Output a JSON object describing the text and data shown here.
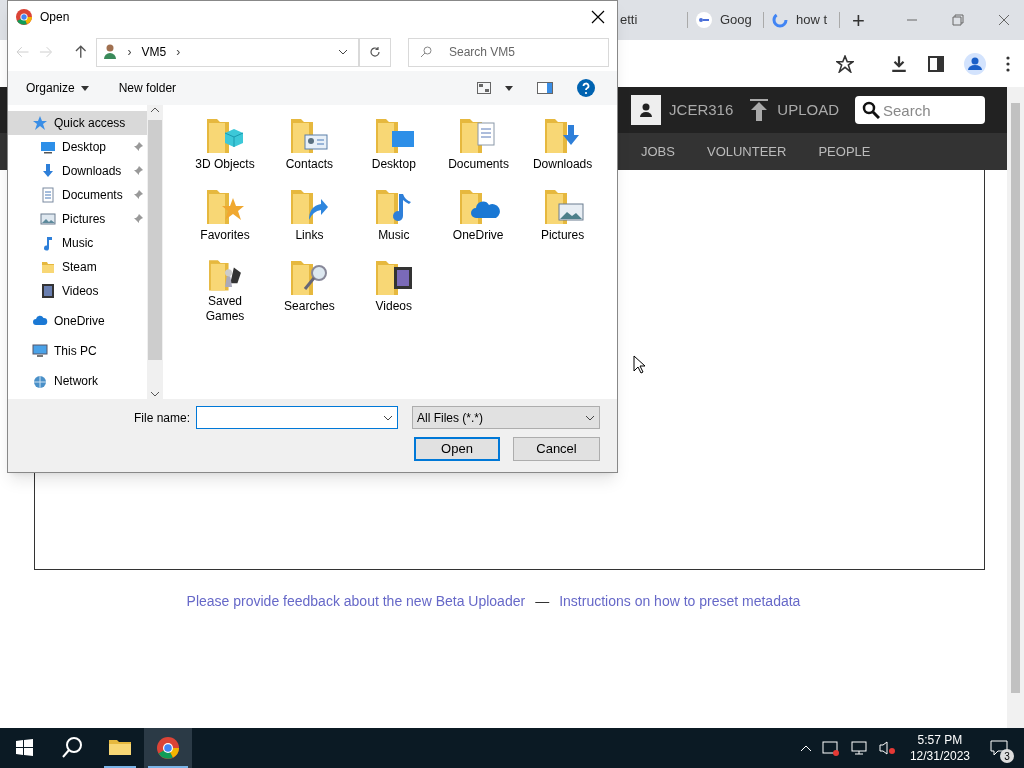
{
  "browser": {
    "tabs": [
      {
        "label": "etti",
        "kind": "plain"
      },
      {
        "label": "Goog",
        "kind": "key"
      },
      {
        "label": "how t",
        "kind": "google"
      }
    ],
    "new_tab": "+"
  },
  "site": {
    "user": "JCER316",
    "upload": "UPLOAD",
    "search": {
      "placeholder": "Search"
    },
    "nav": [
      "JOBS",
      "VOLUNTEER",
      "PEOPLE"
    ],
    "footer": {
      "links": [
        "Please provide feedback about the new Beta Uploader",
        "Instructions on how to preset metadata"
      ],
      "separator": "—"
    }
  },
  "dialog": {
    "title": "Open",
    "path": "VM5",
    "breadcrumb_separators": [
      "›",
      "›"
    ],
    "search": {
      "placeholder": "Search VM5"
    },
    "toolbar": [
      "Organize",
      "New folder"
    ],
    "sidebar": [
      {
        "label": "Quick access",
        "kind": "star",
        "selected": true,
        "children": [
          {
            "label": "Desktop",
            "kind": "desktop",
            "pinned": true,
            "selected": false
          },
          {
            "label": "Downloads",
            "kind": "download",
            "pinned": true,
            "selected": false
          },
          {
            "label": "Documents",
            "kind": "document",
            "pinned": true,
            "selected": false
          },
          {
            "label": "Pictures",
            "kind": "picture",
            "pinned": true,
            "selected": false
          },
          {
            "label": "Music",
            "kind": "music",
            "pinned": false,
            "selected": false
          },
          {
            "label": "Steam",
            "kind": "folder",
            "pinned": false,
            "selected": false
          },
          {
            "label": "Videos",
            "kind": "video",
            "pinned": false,
            "selected": false
          }
        ]
      },
      {
        "label": "OneDrive",
        "kind": "cloud",
        "selected": false
      },
      {
        "label": "This PC",
        "kind": "pc",
        "selected": false
      },
      {
        "label": "Network",
        "kind": "network",
        "selected": false
      }
    ],
    "folders": [
      {
        "label": "3D Objects",
        "kind": "cube"
      },
      {
        "label": "Contacts",
        "kind": "contacts"
      },
      {
        "label": "Desktop",
        "kind": "desktop"
      },
      {
        "label": "Documents",
        "kind": "document"
      },
      {
        "label": "Downloads",
        "kind": "download"
      },
      {
        "label": "Favorites",
        "kind": "star"
      },
      {
        "label": "Links",
        "kind": "link"
      },
      {
        "label": "Music",
        "kind": "music"
      },
      {
        "label": "OneDrive",
        "kind": "cloud"
      },
      {
        "label": "Pictures",
        "kind": "picture"
      },
      {
        "label": "Saved Games",
        "kind": "games"
      },
      {
        "label": "Searches",
        "kind": "search"
      },
      {
        "label": "Videos",
        "kind": "video"
      }
    ],
    "file_name": {
      "label": "File name:"
    },
    "file_type": "All Files (*.*)",
    "buttons": [
      "Open",
      "Cancel"
    ]
  },
  "taskbar": {
    "time": "5:57 PM",
    "date": "12/31/2023",
    "notifications": "3"
  }
}
